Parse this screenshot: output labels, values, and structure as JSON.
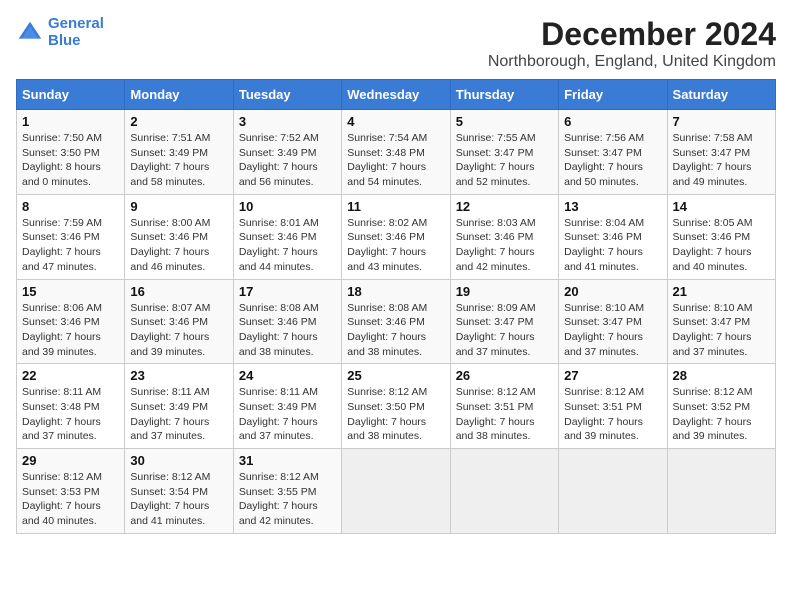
{
  "header": {
    "logo_line1": "General",
    "logo_line2": "Blue",
    "main_title": "December 2024",
    "subtitle": "Northborough, England, United Kingdom"
  },
  "calendar": {
    "days_of_week": [
      "Sunday",
      "Monday",
      "Tuesday",
      "Wednesday",
      "Thursday",
      "Friday",
      "Saturday"
    ],
    "weeks": [
      [
        {
          "day": 1,
          "sunrise": "Sunrise: 7:50 AM",
          "sunset": "Sunset: 3:50 PM",
          "daylight": "Daylight: 8 hours and 0 minutes."
        },
        {
          "day": 2,
          "sunrise": "Sunrise: 7:51 AM",
          "sunset": "Sunset: 3:49 PM",
          "daylight": "Daylight: 7 hours and 58 minutes."
        },
        {
          "day": 3,
          "sunrise": "Sunrise: 7:52 AM",
          "sunset": "Sunset: 3:49 PM",
          "daylight": "Daylight: 7 hours and 56 minutes."
        },
        {
          "day": 4,
          "sunrise": "Sunrise: 7:54 AM",
          "sunset": "Sunset: 3:48 PM",
          "daylight": "Daylight: 7 hours and 54 minutes."
        },
        {
          "day": 5,
          "sunrise": "Sunrise: 7:55 AM",
          "sunset": "Sunset: 3:47 PM",
          "daylight": "Daylight: 7 hours and 52 minutes."
        },
        {
          "day": 6,
          "sunrise": "Sunrise: 7:56 AM",
          "sunset": "Sunset: 3:47 PM",
          "daylight": "Daylight: 7 hours and 50 minutes."
        },
        {
          "day": 7,
          "sunrise": "Sunrise: 7:58 AM",
          "sunset": "Sunset: 3:47 PM",
          "daylight": "Daylight: 7 hours and 49 minutes."
        }
      ],
      [
        {
          "day": 8,
          "sunrise": "Sunrise: 7:59 AM",
          "sunset": "Sunset: 3:46 PM",
          "daylight": "Daylight: 7 hours and 47 minutes."
        },
        {
          "day": 9,
          "sunrise": "Sunrise: 8:00 AM",
          "sunset": "Sunset: 3:46 PM",
          "daylight": "Daylight: 7 hours and 46 minutes."
        },
        {
          "day": 10,
          "sunrise": "Sunrise: 8:01 AM",
          "sunset": "Sunset: 3:46 PM",
          "daylight": "Daylight: 7 hours and 44 minutes."
        },
        {
          "day": 11,
          "sunrise": "Sunrise: 8:02 AM",
          "sunset": "Sunset: 3:46 PM",
          "daylight": "Daylight: 7 hours and 43 minutes."
        },
        {
          "day": 12,
          "sunrise": "Sunrise: 8:03 AM",
          "sunset": "Sunset: 3:46 PM",
          "daylight": "Daylight: 7 hours and 42 minutes."
        },
        {
          "day": 13,
          "sunrise": "Sunrise: 8:04 AM",
          "sunset": "Sunset: 3:46 PM",
          "daylight": "Daylight: 7 hours and 41 minutes."
        },
        {
          "day": 14,
          "sunrise": "Sunrise: 8:05 AM",
          "sunset": "Sunset: 3:46 PM",
          "daylight": "Daylight: 7 hours and 40 minutes."
        }
      ],
      [
        {
          "day": 15,
          "sunrise": "Sunrise: 8:06 AM",
          "sunset": "Sunset: 3:46 PM",
          "daylight": "Daylight: 7 hours and 39 minutes."
        },
        {
          "day": 16,
          "sunrise": "Sunrise: 8:07 AM",
          "sunset": "Sunset: 3:46 PM",
          "daylight": "Daylight: 7 hours and 39 minutes."
        },
        {
          "day": 17,
          "sunrise": "Sunrise: 8:08 AM",
          "sunset": "Sunset: 3:46 PM",
          "daylight": "Daylight: 7 hours and 38 minutes."
        },
        {
          "day": 18,
          "sunrise": "Sunrise: 8:08 AM",
          "sunset": "Sunset: 3:46 PM",
          "daylight": "Daylight: 7 hours and 38 minutes."
        },
        {
          "day": 19,
          "sunrise": "Sunrise: 8:09 AM",
          "sunset": "Sunset: 3:47 PM",
          "daylight": "Daylight: 7 hours and 37 minutes."
        },
        {
          "day": 20,
          "sunrise": "Sunrise: 8:10 AM",
          "sunset": "Sunset: 3:47 PM",
          "daylight": "Daylight: 7 hours and 37 minutes."
        },
        {
          "day": 21,
          "sunrise": "Sunrise: 8:10 AM",
          "sunset": "Sunset: 3:47 PM",
          "daylight": "Daylight: 7 hours and 37 minutes."
        }
      ],
      [
        {
          "day": 22,
          "sunrise": "Sunrise: 8:11 AM",
          "sunset": "Sunset: 3:48 PM",
          "daylight": "Daylight: 7 hours and 37 minutes."
        },
        {
          "day": 23,
          "sunrise": "Sunrise: 8:11 AM",
          "sunset": "Sunset: 3:49 PM",
          "daylight": "Daylight: 7 hours and 37 minutes."
        },
        {
          "day": 24,
          "sunrise": "Sunrise: 8:11 AM",
          "sunset": "Sunset: 3:49 PM",
          "daylight": "Daylight: 7 hours and 37 minutes."
        },
        {
          "day": 25,
          "sunrise": "Sunrise: 8:12 AM",
          "sunset": "Sunset: 3:50 PM",
          "daylight": "Daylight: 7 hours and 38 minutes."
        },
        {
          "day": 26,
          "sunrise": "Sunrise: 8:12 AM",
          "sunset": "Sunset: 3:51 PM",
          "daylight": "Daylight: 7 hours and 38 minutes."
        },
        {
          "day": 27,
          "sunrise": "Sunrise: 8:12 AM",
          "sunset": "Sunset: 3:51 PM",
          "daylight": "Daylight: 7 hours and 39 minutes."
        },
        {
          "day": 28,
          "sunrise": "Sunrise: 8:12 AM",
          "sunset": "Sunset: 3:52 PM",
          "daylight": "Daylight: 7 hours and 39 minutes."
        }
      ],
      [
        {
          "day": 29,
          "sunrise": "Sunrise: 8:12 AM",
          "sunset": "Sunset: 3:53 PM",
          "daylight": "Daylight: 7 hours and 40 minutes."
        },
        {
          "day": 30,
          "sunrise": "Sunrise: 8:12 AM",
          "sunset": "Sunset: 3:54 PM",
          "daylight": "Daylight: 7 hours and 41 minutes."
        },
        {
          "day": 31,
          "sunrise": "Sunrise: 8:12 AM",
          "sunset": "Sunset: 3:55 PM",
          "daylight": "Daylight: 7 hours and 42 minutes."
        },
        null,
        null,
        null,
        null
      ]
    ]
  }
}
